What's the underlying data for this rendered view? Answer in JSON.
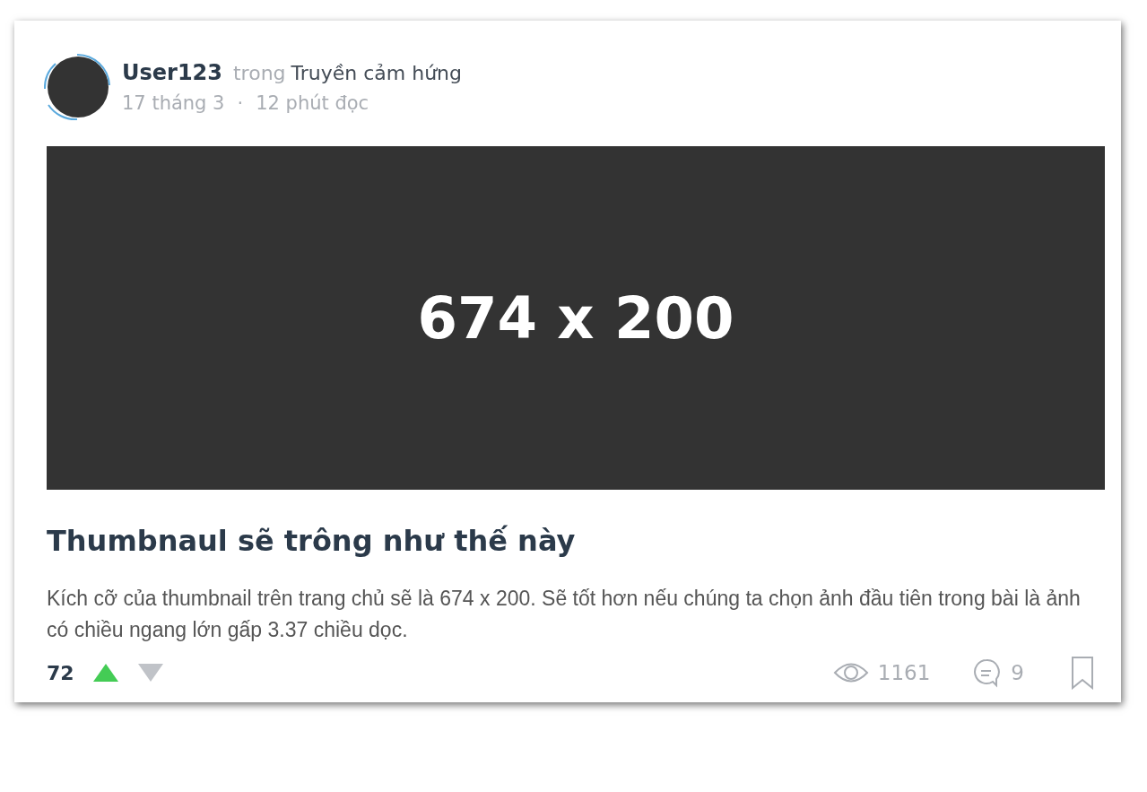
{
  "author": {
    "name": "User123",
    "in_label": "trong",
    "category": "Truyền cảm hứng"
  },
  "meta": {
    "date": "17 tháng 3",
    "separator": "·",
    "read_time": "12 phút đọc"
  },
  "thumbnail": {
    "text": "674 x 200"
  },
  "title": "Thumbnaul sẽ trông như thế này",
  "description": "Kích cỡ của thumbnail trên trang chủ sẽ là 674 x 200. Sẽ tốt hơn nếu chúng ta chọn ảnh đầu tiên trong bài là ảnh có chiều ngang lớn gấp 3.37 chiều dọc.",
  "votes": {
    "score": "72",
    "up": {
      "selected": true
    },
    "down": {
      "selected": false
    }
  },
  "stats": {
    "views": "1161",
    "comments": "9",
    "bookmarked": false
  }
}
